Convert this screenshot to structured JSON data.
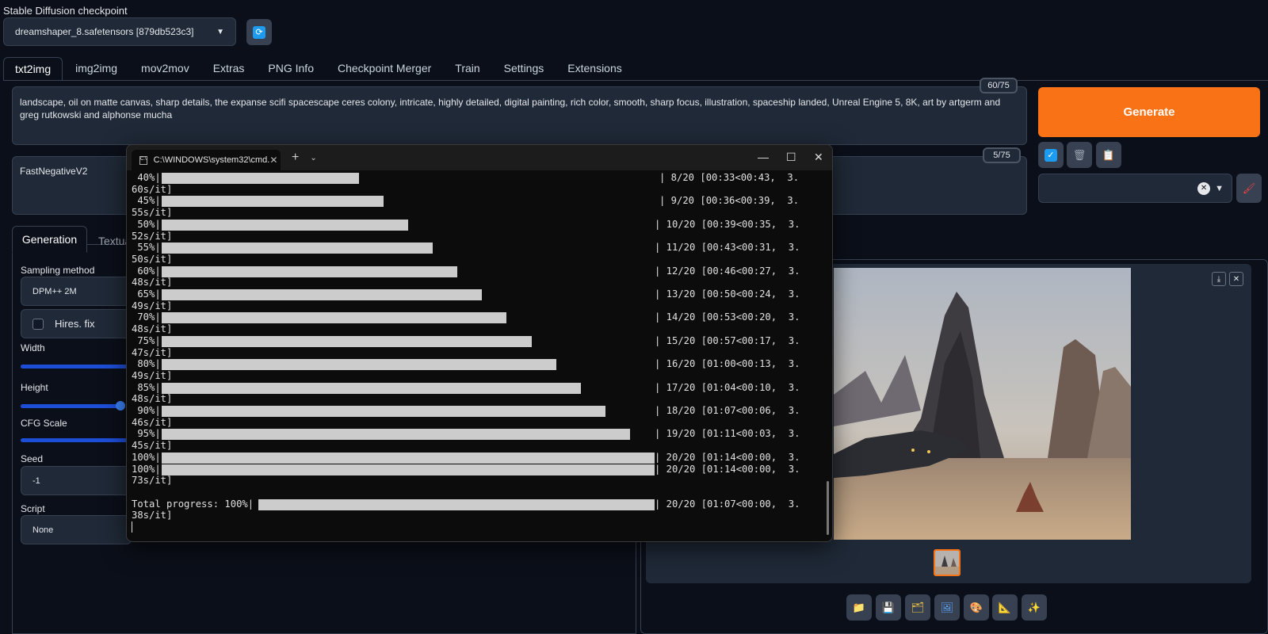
{
  "checkpoint": {
    "label": "Stable Diffusion checkpoint",
    "value": "dreamshaper_8.safetensors [879db523c3]"
  },
  "tabs": [
    "txt2img",
    "img2img",
    "mov2mov",
    "Extras",
    "PNG Info",
    "Checkpoint Merger",
    "Train",
    "Settings",
    "Extensions"
  ],
  "prompt": {
    "text": "landscape, oil on matte canvas, sharp details, the expanse scifi spacescape ceres colony, intricate, highly detailed, digital painting, rich color, smooth, sharp focus, illustration, spaceship landed, Unreal Engine 5, 8K, art by artgerm and greg rutkowski and alphonse mucha",
    "counter": "60/75"
  },
  "negative_prompt": {
    "text": "FastNegativeV2",
    "counter": "5/75"
  },
  "generate_label": "Generate",
  "sub_tabs": {
    "generation": "Generation",
    "textual": "Textua"
  },
  "settings": {
    "sampling_label": "Sampling method",
    "sampling_value": "DPM++ 2M",
    "hires_label": "Hires. fix",
    "width_label": "Width",
    "height_label": "Height",
    "cfg_label": "CFG Scale",
    "seed_label": "Seed",
    "seed_value": "-1",
    "script_label": "Script",
    "script_value": "None"
  },
  "terminal": {
    "tab_title": "C:\\WINDOWS\\system32\\cmd.",
    "lines": [
      {
        "pct": " 40%|",
        "frac": 0.4,
        "stats": "| 8/20 [00:33<00:43,  3.",
        "cont": "60s/it]"
      },
      {
        "pct": " 45%|",
        "frac": 0.45,
        "stats": "| 9/20 [00:36<00:39,  3.",
        "cont": "55s/it]"
      },
      {
        "pct": " 50%|",
        "frac": 0.5,
        "stats": "| 10/20 [00:39<00:35,  3.",
        "cont": "52s/it]"
      },
      {
        "pct": " 55%|",
        "frac": 0.55,
        "stats": "| 11/20 [00:43<00:31,  3.",
        "cont": "50s/it]"
      },
      {
        "pct": " 60%|",
        "frac": 0.6,
        "stats": "| 12/20 [00:46<00:27,  3.",
        "cont": "48s/it]"
      },
      {
        "pct": " 65%|",
        "frac": 0.65,
        "stats": "| 13/20 [00:50<00:24,  3.",
        "cont": "49s/it]"
      },
      {
        "pct": " 70%|",
        "frac": 0.7,
        "stats": "| 14/20 [00:53<00:20,  3.",
        "cont": "48s/it]"
      },
      {
        "pct": " 75%|",
        "frac": 0.75,
        "stats": "| 15/20 [00:57<00:17,  3.",
        "cont": "47s/it]"
      },
      {
        "pct": " 80%|",
        "frac": 0.8,
        "stats": "| 16/20 [01:00<00:13,  3.",
        "cont": "49s/it]"
      },
      {
        "pct": " 85%|",
        "frac": 0.85,
        "stats": "| 17/20 [01:04<00:10,  3.",
        "cont": "48s/it]"
      },
      {
        "pct": " 90%|",
        "frac": 0.9,
        "stats": "| 18/20 [01:07<00:06,  3.",
        "cont": "46s/it]"
      },
      {
        "pct": " 95%|",
        "frac": 0.95,
        "stats": "| 19/20 [01:11<00:03,  3.",
        "cont": "45s/it]"
      }
    ],
    "final_a": {
      "pct": "100%|",
      "stats": "| 20/20 [01:14<00:00,  3."
    },
    "final_b": {
      "pct": "100%|",
      "stats": "| 20/20 [01:14<00:00,  3.",
      "cont": "73s/it]"
    },
    "total": {
      "pct": "Total progress: 100%|",
      "stats": "| 20/20 [01:07<00:00,  3.",
      "cont": "38s/it]"
    }
  },
  "icons": {
    "refresh": "refresh-icon",
    "checkbox_toggle": "check-icon",
    "trash": "trash-icon",
    "clipboard": "clipboard-icon",
    "brush": "brush-icon",
    "folder": "folder-icon",
    "save": "save-icon",
    "zip": "zip-icon",
    "image": "image-icon",
    "palette": "palette-icon",
    "ruler": "ruler-icon",
    "sparkles": "sparkles-icon"
  },
  "colors": {
    "accent": "#f97316",
    "background": "#0b0f19",
    "panel": "#1f2937",
    "slider": "#3b82f6"
  }
}
